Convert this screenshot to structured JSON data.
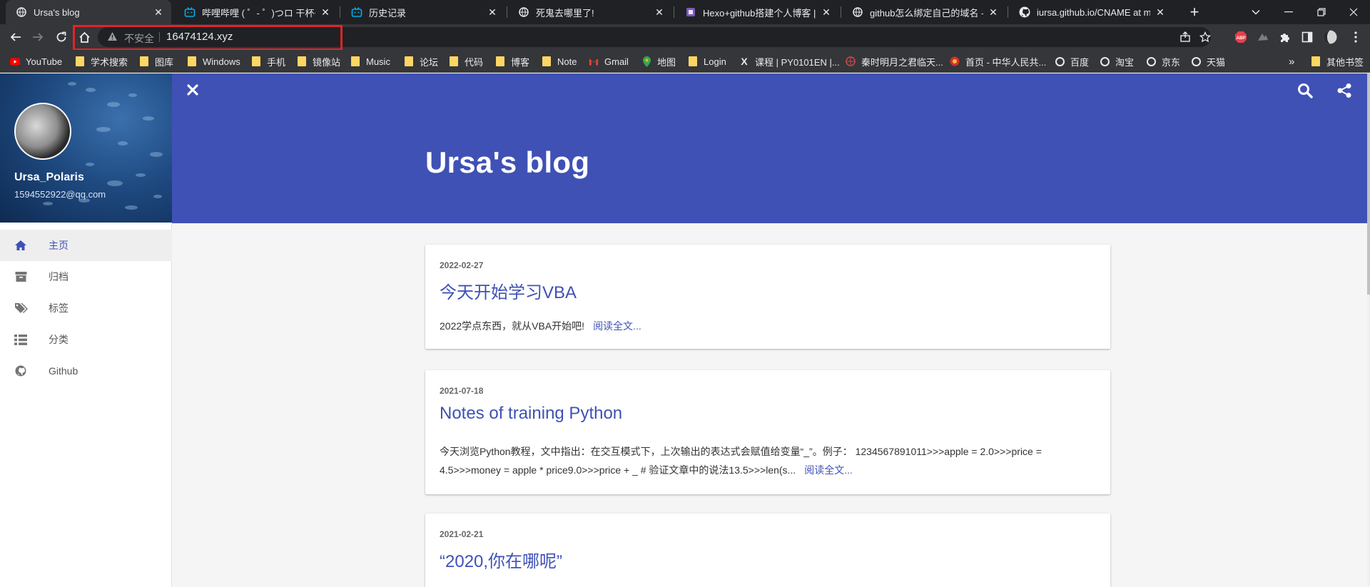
{
  "browser": {
    "tabs": [
      {
        "title": "Ursa's blog",
        "icon": "globe-icon",
        "active": true
      },
      {
        "title": "哔哩哔哩 ( ゜- ゜)つロ 干杯~-bili",
        "icon": "bilibili-icon"
      },
      {
        "title": "历史记录",
        "icon": "bilibili-icon"
      },
      {
        "title": "死鬼去哪里了!",
        "icon": "globe-icon"
      },
      {
        "title": "Hexo+github搭建个人博客 | 武",
        "icon": "site-icon"
      },
      {
        "title": "github怎么绑定自己的域名 - 爱",
        "icon": "globe-icon"
      },
      {
        "title": "iursa.github.io/CNAME at ma",
        "icon": "github-icon"
      }
    ],
    "address": {
      "security_label": "不安全",
      "url": "16474124.xyz"
    },
    "bookmarks": [
      {
        "label": "YouTube",
        "icon": "youtube-icon"
      },
      {
        "label": "学术搜索",
        "icon": "folder-icon"
      },
      {
        "label": "图库",
        "icon": "folder-icon"
      },
      {
        "label": "Windows",
        "icon": "folder-icon"
      },
      {
        "label": "手机",
        "icon": "folder-icon"
      },
      {
        "label": "镜像站",
        "icon": "folder-icon"
      },
      {
        "label": "Music",
        "icon": "folder-icon"
      },
      {
        "label": "论坛",
        "icon": "folder-icon"
      },
      {
        "label": "代码",
        "icon": "folder-icon"
      },
      {
        "label": "博客",
        "icon": "folder-icon"
      },
      {
        "label": "Note",
        "icon": "folder-icon"
      },
      {
        "label": "Gmail",
        "icon": "gmail-icon"
      },
      {
        "label": "地图",
        "icon": "maps-icon"
      },
      {
        "label": "Login",
        "icon": "folder-icon"
      },
      {
        "label": "课程 | PY0101EN |...",
        "icon": "x-icon"
      },
      {
        "label": "秦时明月之君临天...",
        "icon": "site-icon"
      },
      {
        "label": "首页 - 中华人民共...",
        "icon": "emblem-icon"
      },
      {
        "label": "百度",
        "icon": "globe-icon"
      },
      {
        "label": "淘宝",
        "icon": "globe-icon"
      },
      {
        "label": "京东",
        "icon": "globe-icon"
      },
      {
        "label": "天猫",
        "icon": "globe-icon"
      }
    ],
    "other_bookmarks": "其他书签",
    "overflow": "»"
  },
  "sidebar": {
    "name": "Ursa_Polaris",
    "email": "1594552922@qq.com",
    "menu": [
      {
        "label": "主页",
        "icon": "home-icon",
        "active": true
      },
      {
        "label": "归档",
        "icon": "archive-icon"
      },
      {
        "label": "标签",
        "icon": "tags-icon"
      },
      {
        "label": "分类",
        "icon": "list-icon"
      },
      {
        "label": "Github",
        "icon": "github-icon"
      }
    ]
  },
  "header": {
    "title": "Ursa's blog"
  },
  "posts": [
    {
      "date": "2022-02-27",
      "title": "今天开始学习VBA",
      "excerpt": "2022学点东西，就从VBA开始吧!",
      "readmore": "阅读全文..."
    },
    {
      "date": "2021-07-18",
      "title": "Notes of training Python",
      "excerpt": "今天浏览Python教程，文中指出：在交互模式下，上次输出的表达式会赋值给变量“_”。例子： 1234567891011>>>apple = 2.0>>>price = 4.5>>>money = apple * price9.0>>>price + _ # 验证文章中的说法13.5>>>len(s...",
      "readmore": "阅读全文..."
    },
    {
      "date": "2021-02-21",
      "title": "“2020,你在哪呢”",
      "excerpt": "",
      "readmore": ""
    }
  ],
  "colors": {
    "primary": "#3f51b5",
    "chrome_dark": "#202124",
    "chrome": "#35363a",
    "highlight": "#e0232b"
  }
}
